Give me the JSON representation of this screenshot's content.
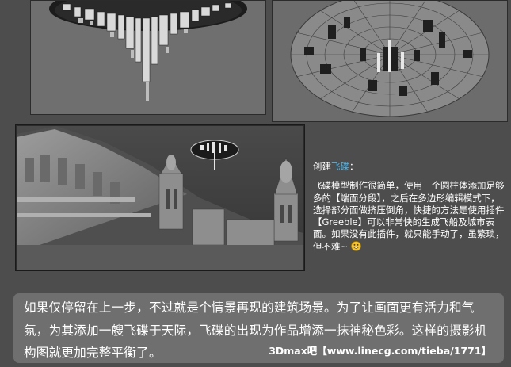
{
  "description": {
    "title_prefix": "创建",
    "title_accent": "飞碟",
    "title_suffix": "：",
    "body": "飞碟模型制作很简单，使用一个圆柱体添加足够多的【端面分段】，之后在多边形编辑模式下，选择部分面做挤压倒角，快捷的方法是使用插件【Greeble】可以非常快的生成飞船及城市表面。如果没有此插件，就只能手动了，虽繁琐，但不难~",
    "emoji_icon": "grinning-face-icon"
  },
  "caption": {
    "text": "如果仅停留在上一步，不过就是个情景再现的建筑场景。为了让画面更有活力和气氛，为其添加一艘飞碟于天际，飞碟的出现为作品增添一抹神秘色彩。这样的摄影机构图就更加完整平衡了。",
    "credit": "3Dmax吧【www.linecg.com/tieba/1771】"
  },
  "colors": {
    "background": "#4d4d4d",
    "accent": "#4fb6ea",
    "caption_box": "#6f6f6f"
  }
}
